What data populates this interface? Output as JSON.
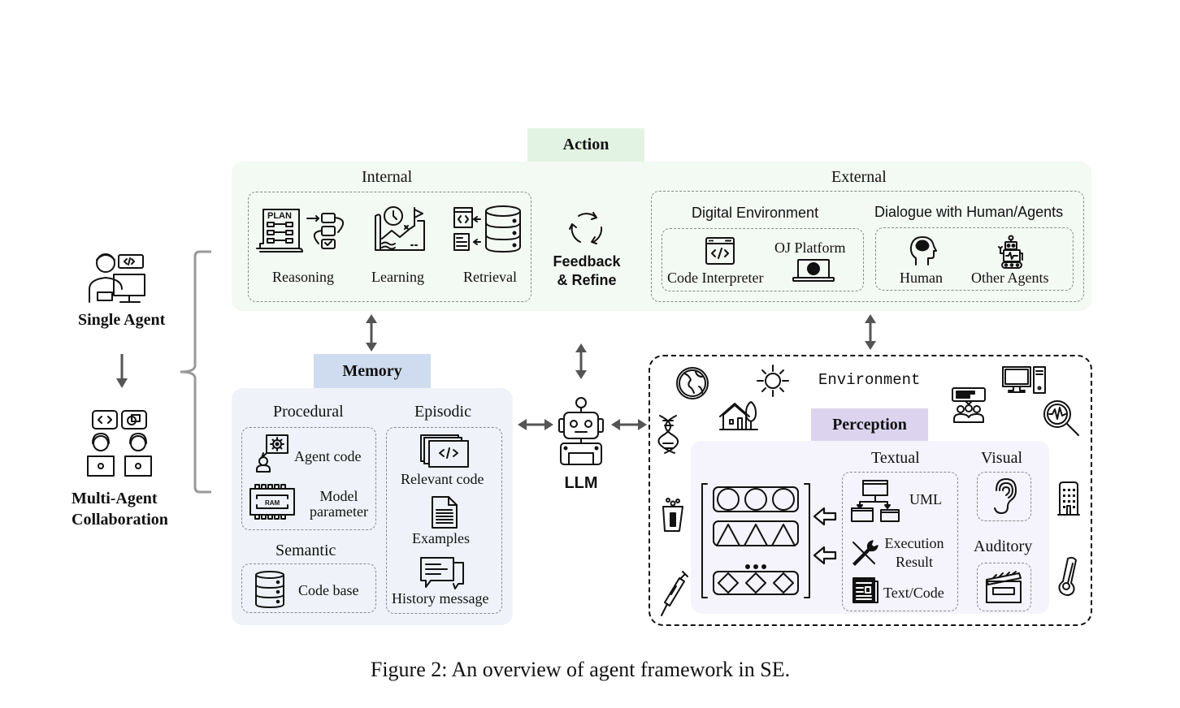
{
  "left": {
    "single_agent": "Single Agent",
    "multi_agent_line1": "Multi-Agent",
    "multi_agent_line2": "Collaboration"
  },
  "action": {
    "title": "Action",
    "internal": {
      "title": "Internal",
      "items": [
        "Reasoning",
        "Learning",
        "Retrieval"
      ]
    },
    "feedback_line1": "Feedback",
    "feedback_line2": "& Refine",
    "external": {
      "title": "External",
      "digital": {
        "title": "Digital Environment",
        "items": [
          "Code Interpreter",
          "OJ Platform"
        ]
      },
      "dialogue": {
        "title": "Dialogue with Human/Agents",
        "items": [
          "Human",
          "Other Agents"
        ]
      }
    },
    "colors": {
      "tag_bg": "#e3f3e3",
      "panel_bg": "#f3f9f3"
    }
  },
  "memory": {
    "title": "Memory",
    "procedural": {
      "title": "Procedural",
      "agent_code": "Agent code",
      "model_line1": "Model",
      "model_line2": "parameter",
      "ram_label": "RAM"
    },
    "semantic": {
      "title": "Semantic",
      "code_base": "Code base"
    },
    "episodic": {
      "title": "Episodic",
      "items": [
        "Relevant code",
        "Examples",
        "History message"
      ]
    },
    "colors": {
      "tag_bg": "#cfdcef",
      "panel_bg": "#eff3f9"
    }
  },
  "llm": {
    "label": "LLM"
  },
  "environment": {
    "title": "Environment",
    "perception": {
      "title": "Perception",
      "textual": {
        "title": "Textual",
        "uml": "UML",
        "exec_line1": "Execution",
        "exec_line2": "Result",
        "text_code": "Text/Code"
      },
      "visual": {
        "title": "Visual"
      },
      "auditory": {
        "title": "Auditory"
      },
      "colors": {
        "tag_bg": "#dcd4ef",
        "panel_bg": "#f5f3fb"
      }
    }
  },
  "caption": "Figure 2: An overview of agent framework in SE."
}
